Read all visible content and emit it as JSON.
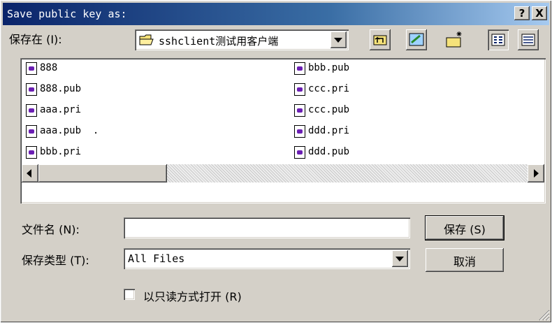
{
  "window": {
    "title": "Save public key as:"
  },
  "title_buttons": {
    "help": "?",
    "close": "X"
  },
  "location": {
    "label": "保存在 (I):",
    "current": "sshclient测试用客户端"
  },
  "files": {
    "column1": [
      "888",
      "888.pub",
      "aaa.pri",
      "aaa.pub  .",
      "bbb.pri"
    ],
    "column2": [
      "bbb.pub",
      "ccc.pri",
      "ccc.pub",
      "ddd.pri",
      "ddd.pub"
    ]
  },
  "filename": {
    "label": "文件名 (N):",
    "value": ""
  },
  "filetype": {
    "label": "保存类型 (T):",
    "value": "All Files"
  },
  "readonly": {
    "label": "以只读方式打开 (R)",
    "checked": false
  },
  "buttons": {
    "save": "保存 (S)",
    "cancel": "取消"
  },
  "colors": {
    "title_start": "#0a246a",
    "title_end": "#a6caf0",
    "face": "#d4d0c8",
    "file_icon": "#6b1fb3"
  },
  "icons": [
    "up-folder-icon",
    "desktop-icon",
    "new-folder-icon",
    "list-view-icon",
    "details-view-icon",
    "folder-icon",
    "file-icon",
    "size-grip-icon"
  ]
}
